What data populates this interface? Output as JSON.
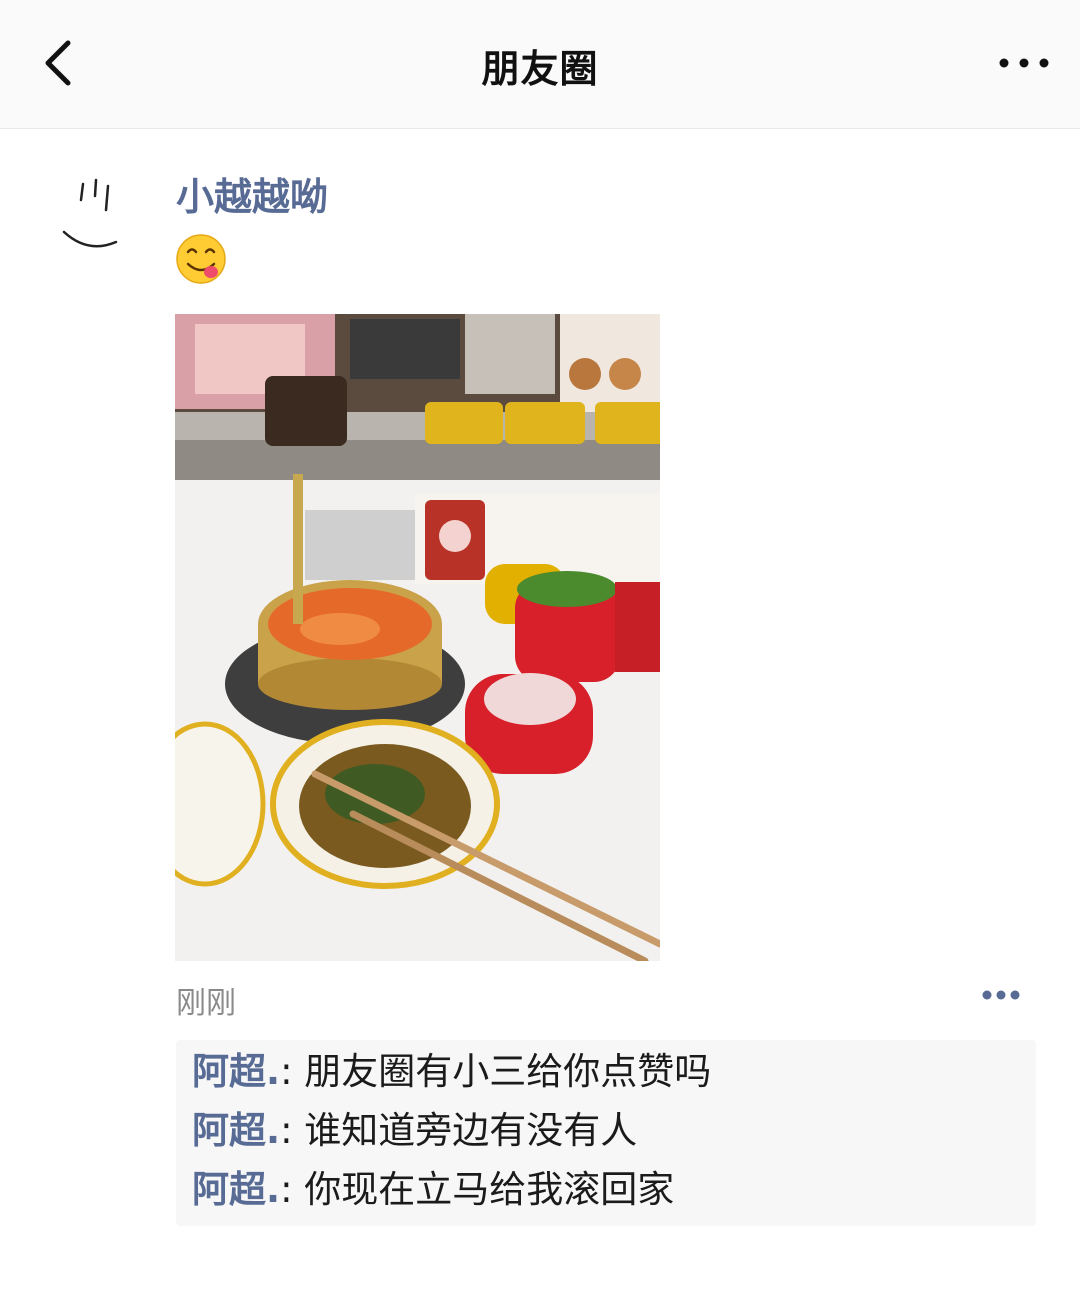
{
  "header": {
    "title": "朋友圈",
    "back_icon": "chevron-left-icon",
    "more_icon": "more-horizontal-icon"
  },
  "post": {
    "username": "小越越呦",
    "avatar_icon": "smiley-face-icon",
    "text_emoji_icon": "yum-face-emoji-icon",
    "photo_icon": "hotpot-photo",
    "timestamp": "刚刚",
    "more_icon": "more-dots-icon",
    "comments": [
      {
        "author": "阿超.",
        "sep": ": ",
        "text": "朋友圈有小三给你点赞吗"
      },
      {
        "author": "阿超.",
        "sep": ": ",
        "text": "谁知道旁边有没有人"
      },
      {
        "author": "阿超.",
        "sep": ": ",
        "text": "你现在立马给我滚回家"
      }
    ]
  },
  "colors": {
    "link": "#576b95",
    "nav_bg": "#fafafa",
    "comment_bg": "#f7f7f7",
    "timestamp": "#8a8a8a"
  }
}
